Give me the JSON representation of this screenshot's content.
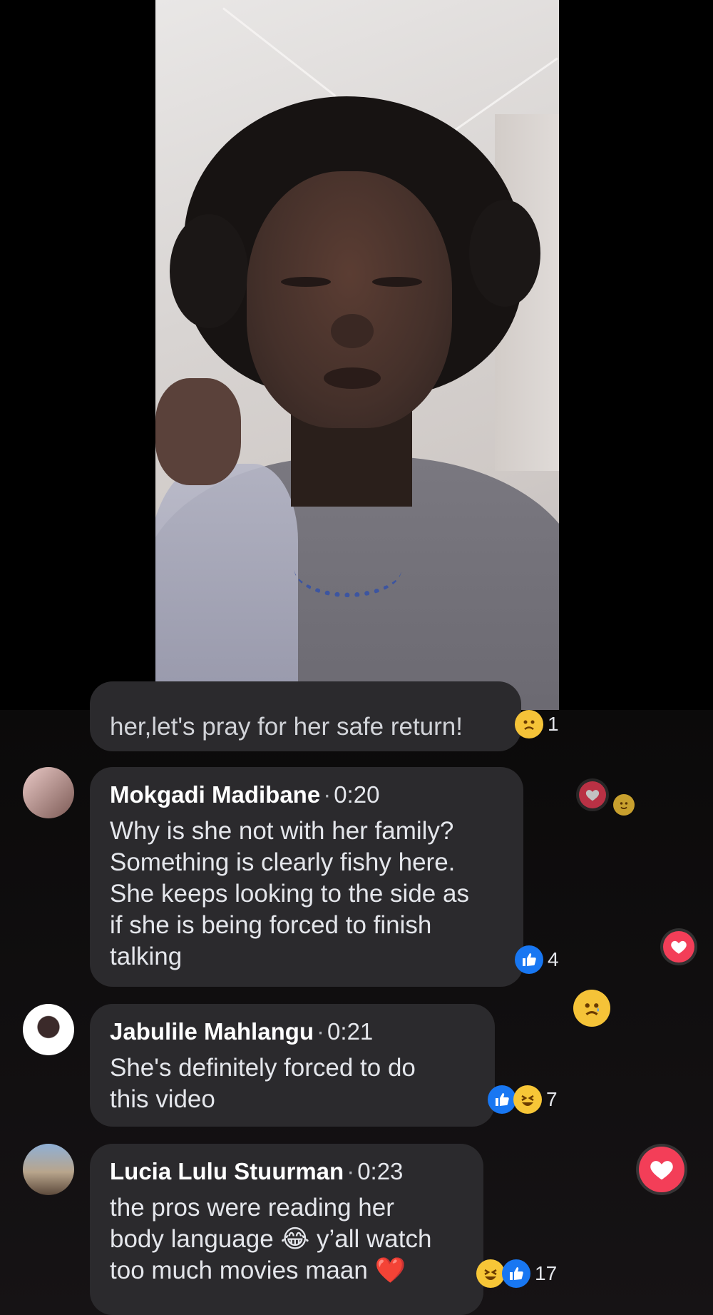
{
  "comments": [
    {
      "text": "her,let's pray for her safe return!",
      "reaction_count": "1",
      "reaction_icons": [
        "sad-care-icon"
      ]
    },
    {
      "author": "Mokgadi Madibane",
      "time": "0:20",
      "lines": [
        "Why is she not with her family?",
        "Something is clearly fishy here.",
        "She keeps looking to the side as",
        "if she is being forced to finish",
        "talking"
      ],
      "reaction_count": "4",
      "reaction_icons": [
        "like-icon"
      ]
    },
    {
      "author": "Jabulile Mahlangu",
      "time": "0:21",
      "lines": [
        "She's definitely forced to do",
        "this video"
      ],
      "reaction_count": "7",
      "reaction_icons": [
        "like-icon",
        "haha-icon"
      ]
    },
    {
      "author": "Lucia Lulu Stuurman",
      "time": "0:23",
      "lines": [
        "the pros were reading her",
        "body language 😂 y’all watch",
        "too much movies maan ❤️"
      ],
      "reaction_count": "17",
      "reaction_icons": [
        "haha-icon",
        "like-icon"
      ]
    }
  ],
  "separator": "·",
  "colors": {
    "bubble": "#2b2a2d",
    "like": "#1877f2",
    "heart": "#f33e58",
    "haha": "#f7c637"
  }
}
